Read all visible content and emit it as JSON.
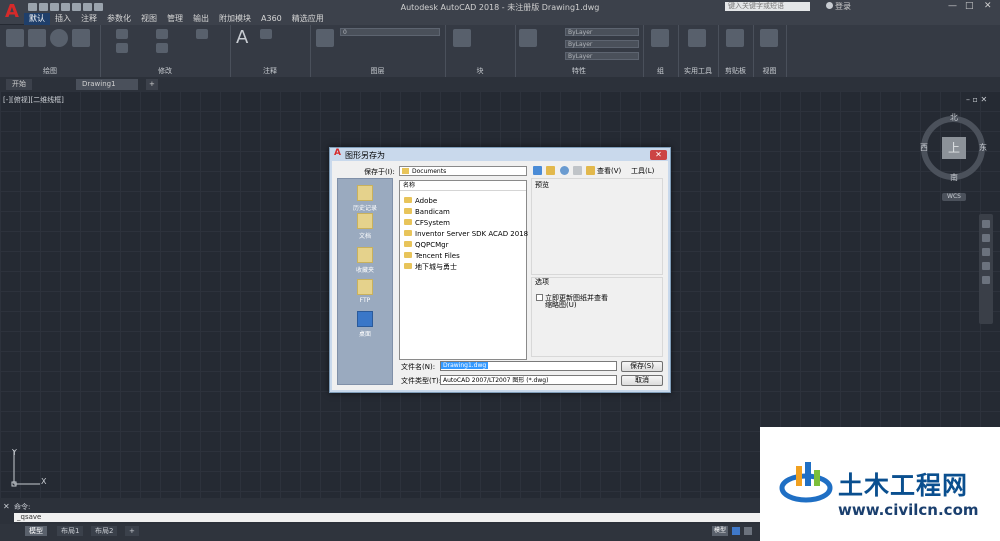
{
  "window": {
    "title": "Autodesk AutoCAD 2018 - 未注册版    Drawing1.dwg",
    "search_placeholder": "键入关键字或短语",
    "login": "登录",
    "minimize": "—",
    "maximize": "□",
    "close": "✕"
  },
  "menu": {
    "items": [
      "默认",
      "插入",
      "注释",
      "参数化",
      "视图",
      "管理",
      "输出",
      "附加模块",
      "A360",
      "精选应用"
    ]
  },
  "ribbon": {
    "panels": [
      "绘图",
      "修改",
      "注释",
      "图层",
      "块",
      "特性",
      "组",
      "实用工具",
      "剪贴板",
      "视图"
    ],
    "layer_value": "0",
    "prop_values": [
      "ByLayer",
      "ByLayer",
      "ByLayer"
    ]
  },
  "doc_tabs": [
    "开始",
    "Drawing1",
    "+"
  ],
  "viewport_label": "[-][俯视][二维线框]",
  "viewcube": {
    "north": "北",
    "south": "南",
    "east": "东",
    "west": "西",
    "face": "上",
    "wcs": "WCS"
  },
  "ucs": {
    "x": "X",
    "y": "Y"
  },
  "command": {
    "history": "命令:",
    "input": "_qsave"
  },
  "layout_tabs": [
    "模型",
    "布局1",
    "布局2",
    "+"
  ],
  "status": {
    "model": "模型"
  },
  "dialog": {
    "title": "图形另存为",
    "close": "✕",
    "save_in_label": "保存于(I):",
    "save_in_value": "Documents",
    "views_label": "查看(V)",
    "tools_label": "工具(L)",
    "places": [
      "历史记录",
      "文档",
      "收藏夹",
      "FTP",
      "桌面"
    ],
    "list_header": "名称",
    "files": [
      "Adobe",
      "Bandicam",
      "CFSystem",
      "Inventor Server SDK ACAD 2018",
      "QQPCMgr",
      "Tencent Files",
      "地下城与勇士"
    ],
    "preview_label": "预览",
    "options_label": "选项",
    "checkbox_label": "立即更新图纸并查看",
    "checkbox_label2": "缩略图(U)",
    "filename_label": "文件名(N):",
    "filename_value": "Drawing1.dwg",
    "filetype_label": "文件类型(T):",
    "filetype_value": "AutoCAD 2007/LT2007 图形 (*.dwg)",
    "save_button": "保存(S)",
    "cancel_button": "取消"
  },
  "watermark": {
    "title": "土木工程网",
    "url": "www.civilcn.com"
  }
}
